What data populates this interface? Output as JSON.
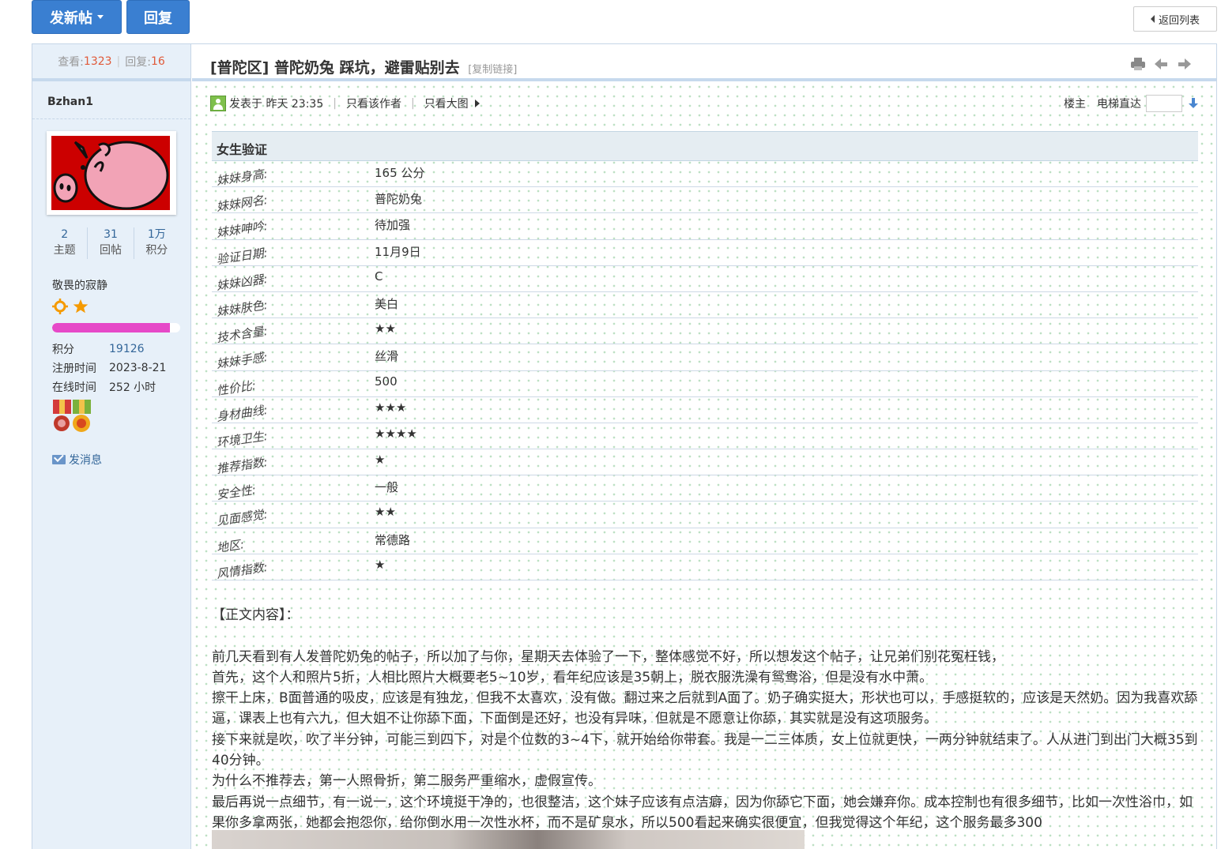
{
  "toolbar": {
    "new_post_label": "发新帖",
    "reply_label": "回复",
    "back_label": "返回列表"
  },
  "thread": {
    "views_label": "查看:",
    "views": "1323",
    "replies_label": "回复:",
    "replies": "16",
    "title": "[普陀区] 普陀奶兔 踩坑，避雷贴别去",
    "copy_link": "[复制链接]"
  },
  "author": {
    "name": "Bzhan1",
    "avatar_icon": "pig-avatar",
    "stats": [
      {
        "value": "2",
        "label": "主题"
      },
      {
        "value": "31",
        "label": "回帖"
      },
      {
        "value": "1万",
        "label": "积分"
      }
    ],
    "rank_title": "敬畏的寂静",
    "rank_progress": 0.92,
    "rank_bar_color": "#e649c8",
    "info": [
      {
        "key": "积分",
        "value": "19126"
      },
      {
        "key": "注册时间",
        "value": "2023-8-21"
      },
      {
        "key": "在线时间",
        "value": "252 小时"
      }
    ],
    "send_message": "发消息"
  },
  "post_meta": {
    "posted_at": "发表于 昨天 23:35",
    "only_author": "只看该作者",
    "only_images": "只看大图",
    "floor_label": "楼主",
    "jump_label": "电梯直达"
  },
  "verify": {
    "heading": "女生验证",
    "rows": [
      {
        "key": "妹妹身高:",
        "value": "165 公分"
      },
      {
        "key": "妹妹网名:",
        "value": "普陀奶兔"
      },
      {
        "key": "妹妹呻吟:",
        "value": "待加强"
      },
      {
        "key": "验证日期:",
        "value": "11月9日"
      },
      {
        "key": "妹妹凶器:",
        "value": "C"
      },
      {
        "key": "妹妹肤色:",
        "value": "美白"
      },
      {
        "key": "技术含量:",
        "value": "★★"
      },
      {
        "key": "妹妹手感:",
        "value": "丝滑"
      },
      {
        "key": "性价比:",
        "value": "500"
      },
      {
        "key": "身材曲线:",
        "value": "★★★"
      },
      {
        "key": "环境卫生:",
        "value": "★★★★"
      },
      {
        "key": "推荐指数:",
        "value": "★"
      },
      {
        "key": "安全性:",
        "value": "一般"
      },
      {
        "key": "见面感觉:",
        "value": "★★"
      },
      {
        "key": "地区:",
        "value": "常德路"
      },
      {
        "key": "风情指数:",
        "value": "★"
      }
    ]
  },
  "body": {
    "lines": [
      "【正文内容】：",
      "",
      "前几天看到有人发普陀奶兔的帖子，所以加了与你，星期天去体验了一下，整体感觉不好，所以想发这个帖子，让兄弟们别花冤枉钱，",
      "首先，这个人和照片5折，人相比照片大概要老5~10岁，看年纪应该是35朝上，脱衣服洗澡有鸳鸯浴，但是没有水中萧。",
      "擦干上床，B面普通的吸皮，应该是有独龙，但我不太喜欢，没有做。翻过来之后就到A面了。奶子确实挺大，形状也可以，手感挺软的，应该是天然奶。因为我喜欢舔逼，课表上也有六九，但大姐不让你舔下面，下面倒是还好，也没有异味，但就是不愿意让你舔，其实就是没有这项服务。",
      "接下来就是吹，吹了半分钟，可能三到四下，对是个位数的3~4下，就开始给你带套。我是一二三体质，女上位就更快，一两分钟就结束了。人从进门到出门大概35到40分钟。",
      "为什么不推荐去，第一人照骨折，第二服务严重缩水，虚假宣传。",
      "最后再说一点细节，有一说一，这个环境挺干净的，也很整洁，这个妹子应该有点洁癖，因为你舔它下面，她会嫌弃你。成本控制也有很多细节，比如一次性浴巾，如果你多拿两张，她都会抱怨你，给你倒水用一次性水杯，而不是矿泉水，所以500看起来确实很便宜，但我觉得这个年纪，这个服务最多300"
    ]
  },
  "colors": {
    "primary_button": "#3a7fd1",
    "sidebar_bg": "#e7f0f9",
    "link": "#336699",
    "count_accent": "#e05a3a"
  }
}
